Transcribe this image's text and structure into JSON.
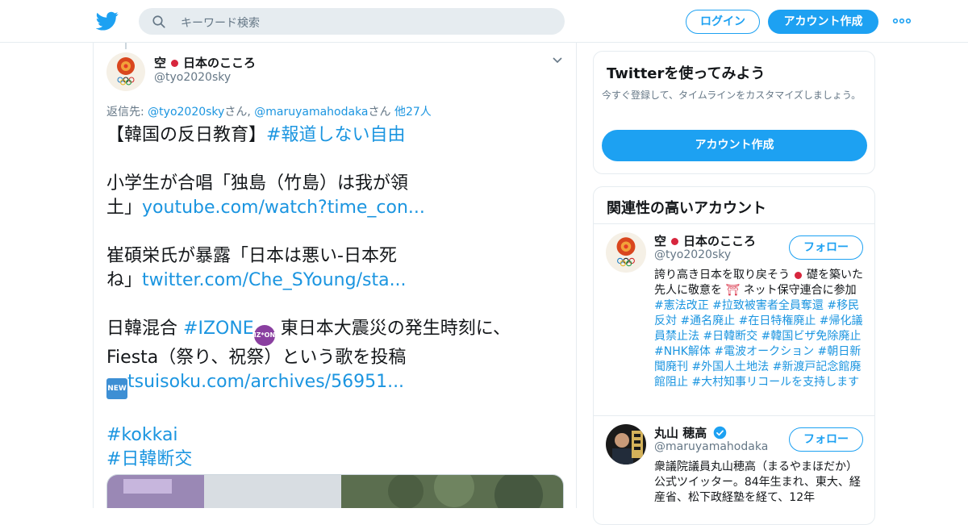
{
  "header": {
    "search_placeholder": "キーワード検索",
    "login_label": "ログイン",
    "signup_label": "アカウント作成"
  },
  "tweet": {
    "author_name": "日本のこころ",
    "author_prefix": "空",
    "author_handle": "@tyo2020sky",
    "replying_label": "返信先:",
    "reply_handle_1": "@tyo2020sky",
    "reply_san_1": "さん,",
    "reply_handle_2": "@maruyamahodaka",
    "reply_san_2": "さん",
    "reply_others": "他27人",
    "line1_text": "【韓国の反日教育】",
    "line1_tag": "#報道しない自由",
    "line2_text": "小学生が合唱「独島（竹島）は我が領",
    "line3_text": "土」",
    "line3_link": "youtube.com/watch?time_con...",
    "line4_text": "崔碩栄氏が暴露「日本は悪い-日本死",
    "line5_text": "ね」",
    "line5_link": "twitter.com/Che_SYoung/sta...",
    "line6_text": "日韓混合",
    "line6_tag": "#IZONE",
    "izone_badge": "IZ*ONE",
    "line6_rest": "東日本大震災の発生時刻に、",
    "line7_text": "Fiesta（祭り、祝祭）という歌を投稿",
    "new_badge": "NEW",
    "line8_link": "tsuisoku.com/archives/56951...",
    "tag_kokkai": "#kokkai",
    "tag_dankou": "#日韓断交"
  },
  "try_card": {
    "title": "Twitterを使ってみよう",
    "description": "今すぐ登録して、タイムラインをカスタマイズしましょう。",
    "button_label": "アカウント作成"
  },
  "related": {
    "title": "関連性の高いアカウント",
    "accounts": [
      {
        "prefix": "空",
        "name": "日本のこころ",
        "handle": "@tyo2020sky",
        "follow_label": "フォロー",
        "bio_text_1": "誇り高き日本を取り戻そう",
        "bio_text_2": "礎を築いた先人に敬意を",
        "bio_text_3": "ネット保守連合に参加",
        "bio_tags": "#憲法改正 #拉致被害者全員奪還 #移民反対 #通名廃止 #在日特権廃止 #帰化議員禁止法 #日韓断交 #韓国ビザ免除廃止 #NHK解体 #電波オークション #朝日新聞廃刊 #外国人土地法 #新渡戸記念館廃館阻止 #大村知事リコールを支持します"
      },
      {
        "name": "丸山 穂高",
        "handle": "@maruyamahodaka",
        "follow_label": "フォロー",
        "bio": "衆議院議員丸山穂高（まるやまほだか）公式ツイッター。84年生まれ、東大、経産省、松下政経塾を経て、12年"
      }
    ]
  },
  "colors": {
    "accent": "#1da1f2",
    "link": "#1b95e0",
    "muted": "#657786"
  }
}
